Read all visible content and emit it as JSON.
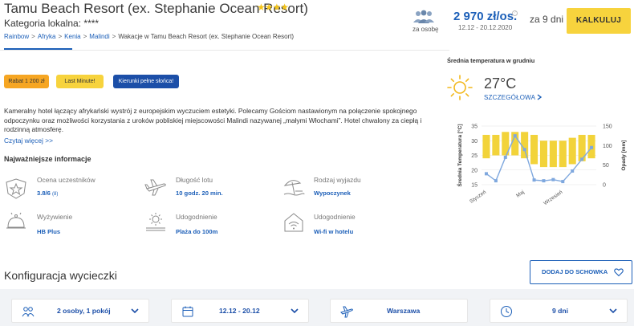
{
  "header": {
    "title": "Tamu Beach Resort (ex. Stephanie Ocean Resort)",
    "stars": "★★★★",
    "category": "Kategoria lokalna: ****",
    "breadcrumbs": [
      "Rainbow",
      "Afryka",
      "Kenia",
      "Malindi",
      "Wakacje w Tamu Beach Resort (ex. Stephanie Ocean Resort)"
    ],
    "per_person_label": "za osobę",
    "price": "2 970 zł/os.",
    "info_mark": "?",
    "date_range": "12.12 - 20.12.2020",
    "duration": "za 9 dni",
    "calc_button": "KALKULUJ"
  },
  "badges": [
    "Rabat 1 200 zł",
    "Last Minute!",
    "Kierunki pełne słońca!"
  ],
  "description": "Kameralny hotel łączący afrykański wystrój z europejskim wyczuciem estetyki. Polecamy Gościom nastawionym na połączenie spokojnego odpoczynku oraz możliwości korzystania z uroków pobliskiej miejscowości Malindi nazywanej „małymi Włochami”. Hotel chwalony za ciepłą i rodzinną atmosferę.",
  "read_more": "Czytaj więcej >>",
  "info": {
    "heading": "Najważniejsze informacje",
    "items": [
      {
        "label": "Ocena uczestników",
        "value": "3.8/6",
        "extra": "(8)",
        "icon": "rating-star-icon"
      },
      {
        "label": "Długość lotu",
        "value": "10 godz. 20 min.",
        "icon": "airplane-icon"
      },
      {
        "label": "Rodzaj wyjazdu",
        "value": "Wypoczynek",
        "icon": "beach-umbrella-icon"
      },
      {
        "label": "Wyżywienie",
        "value": "HB Plus",
        "icon": "food-cloche-icon"
      },
      {
        "label": "Udogodnienie",
        "value": "Plaża do 100m",
        "icon": "sun-water-icon"
      },
      {
        "label": "Udogodnienie",
        "value": "Wi-fi w hotelu",
        "icon": "wifi-house-icon"
      }
    ]
  },
  "weather": {
    "title": "Średnia temperatura w grudniu",
    "temperature": "27°C",
    "detail_link": "SZCZEGÓŁOWA",
    "icon": "sun-icon"
  },
  "chart_data": {
    "type": "bar",
    "months": 12,
    "x_tick_labels": [
      "Styczeń",
      "Maj",
      "Wrzesień"
    ],
    "temperature_ranges": [
      [
        24,
        32
      ],
      [
        25,
        32
      ],
      [
        25,
        33
      ],
      [
        25,
        33
      ],
      [
        24,
        33
      ],
      [
        22,
        32
      ],
      [
        21,
        30
      ],
      [
        21,
        30
      ],
      [
        21,
        30
      ],
      [
        22,
        31
      ],
      [
        23,
        32
      ],
      [
        24,
        32
      ]
    ],
    "precipitation": [
      28,
      10,
      70,
      125,
      90,
      12,
      10,
      13,
      8,
      35,
      65,
      95
    ],
    "left_axis": {
      "label": "Średnia Temperatura [°C]",
      "ticks": [
        15,
        20,
        25,
        30,
        35
      ],
      "range": [
        15,
        35
      ]
    },
    "right_axis": {
      "label": "Opady [mm]",
      "ticks": [
        0,
        50,
        100,
        150
      ],
      "range": [
        0,
        150
      ]
    },
    "bar_color": "#f2d33a",
    "line_color": "#7fa8de"
  },
  "config": {
    "title": "Konfiguracja wycieczki",
    "fav_button": "DODAJ DO SCHOWKA",
    "selectors": [
      {
        "value": "2 osoby, 1 pokój",
        "icon": "people-icon"
      },
      {
        "value": "12.12 - 20.12",
        "icon": "calendar-icon"
      },
      {
        "value": "Warszawa",
        "icon": "airplane-icon"
      },
      {
        "value": "9 dni",
        "icon": "clock-icon"
      }
    ]
  },
  "colors": {
    "accent": "#1c5fb8",
    "cta": "#f7d33d",
    "badge_orange": "#f6a623",
    "badge_blue": "#1c4fa8"
  }
}
